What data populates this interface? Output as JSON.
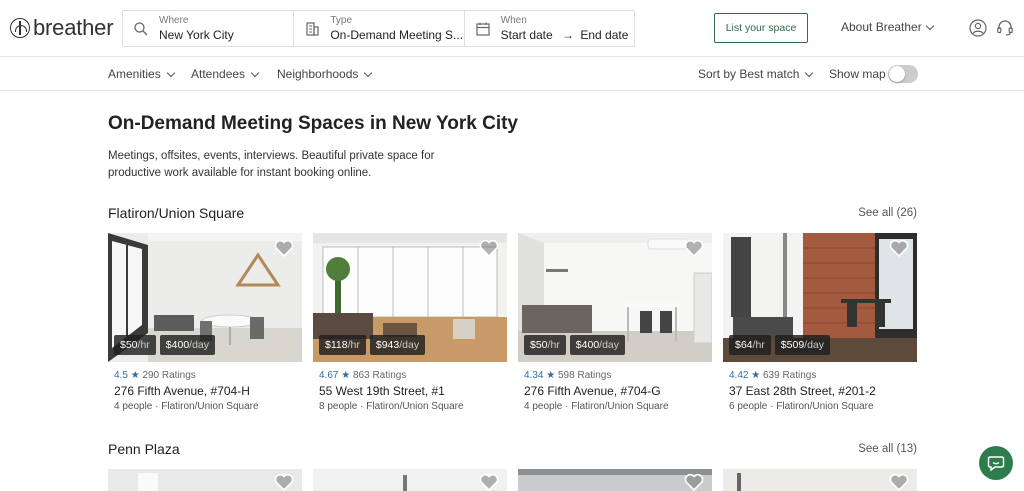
{
  "brand": {
    "name": "breather"
  },
  "search": {
    "where": {
      "label": "Where",
      "value": "New York City"
    },
    "type": {
      "label": "Type",
      "value": "On-Demand Meeting S..."
    },
    "when": {
      "label": "When",
      "start": "Start date",
      "arrow": "→",
      "end": "End date"
    }
  },
  "header": {
    "list_space": "List your space",
    "about": "About Breather"
  },
  "filters": {
    "amenities": "Amenities",
    "attendees": "Attendees",
    "neighborhoods": "Neighborhoods",
    "sort": "Sort by Best match",
    "show_map": "Show map",
    "show_map_on": false
  },
  "main": {
    "title": "On-Demand Meeting Spaces in New York City",
    "description": "Meetings, offsites, events, interviews. Beautiful private space for productive work available for instant booking online."
  },
  "sections": [
    {
      "title": "Flatiron/Union Square",
      "see_all": "See all (26)",
      "cards": [
        {
          "hourly": "$50",
          "daily": "$400",
          "rating": "4.5",
          "ratings_count": "290 Ratings",
          "name": "276 Fifth Avenue, #704-H",
          "meta": "4 people · Flatiron/Union Square"
        },
        {
          "hourly": "$118",
          "daily": "$943",
          "rating": "4.67",
          "ratings_count": "863 Ratings",
          "name": "55 West 19th Street, #1",
          "meta": "8 people · Flatiron/Union Square"
        },
        {
          "hourly": "$50",
          "daily": "$400",
          "rating": "4.34",
          "ratings_count": "598 Ratings",
          "name": "276 Fifth Avenue, #704-G",
          "meta": "4 people · Flatiron/Union Square"
        },
        {
          "hourly": "$64",
          "daily": "$509",
          "rating": "4.42",
          "ratings_count": "639 Ratings",
          "name": "37 East 28th Street, #201-2",
          "meta": "6 people · Flatiron/Union Square"
        }
      ]
    },
    {
      "title": "Penn Plaza",
      "see_all": "See all (13)"
    }
  ],
  "units": {
    "hour": "/hr",
    "day": "/day",
    "star": "★"
  },
  "colors": {
    "accent_green": "#2e6b4a",
    "rating_blue": "#2f6fa8",
    "chat_green": "#2e7b4e"
  }
}
